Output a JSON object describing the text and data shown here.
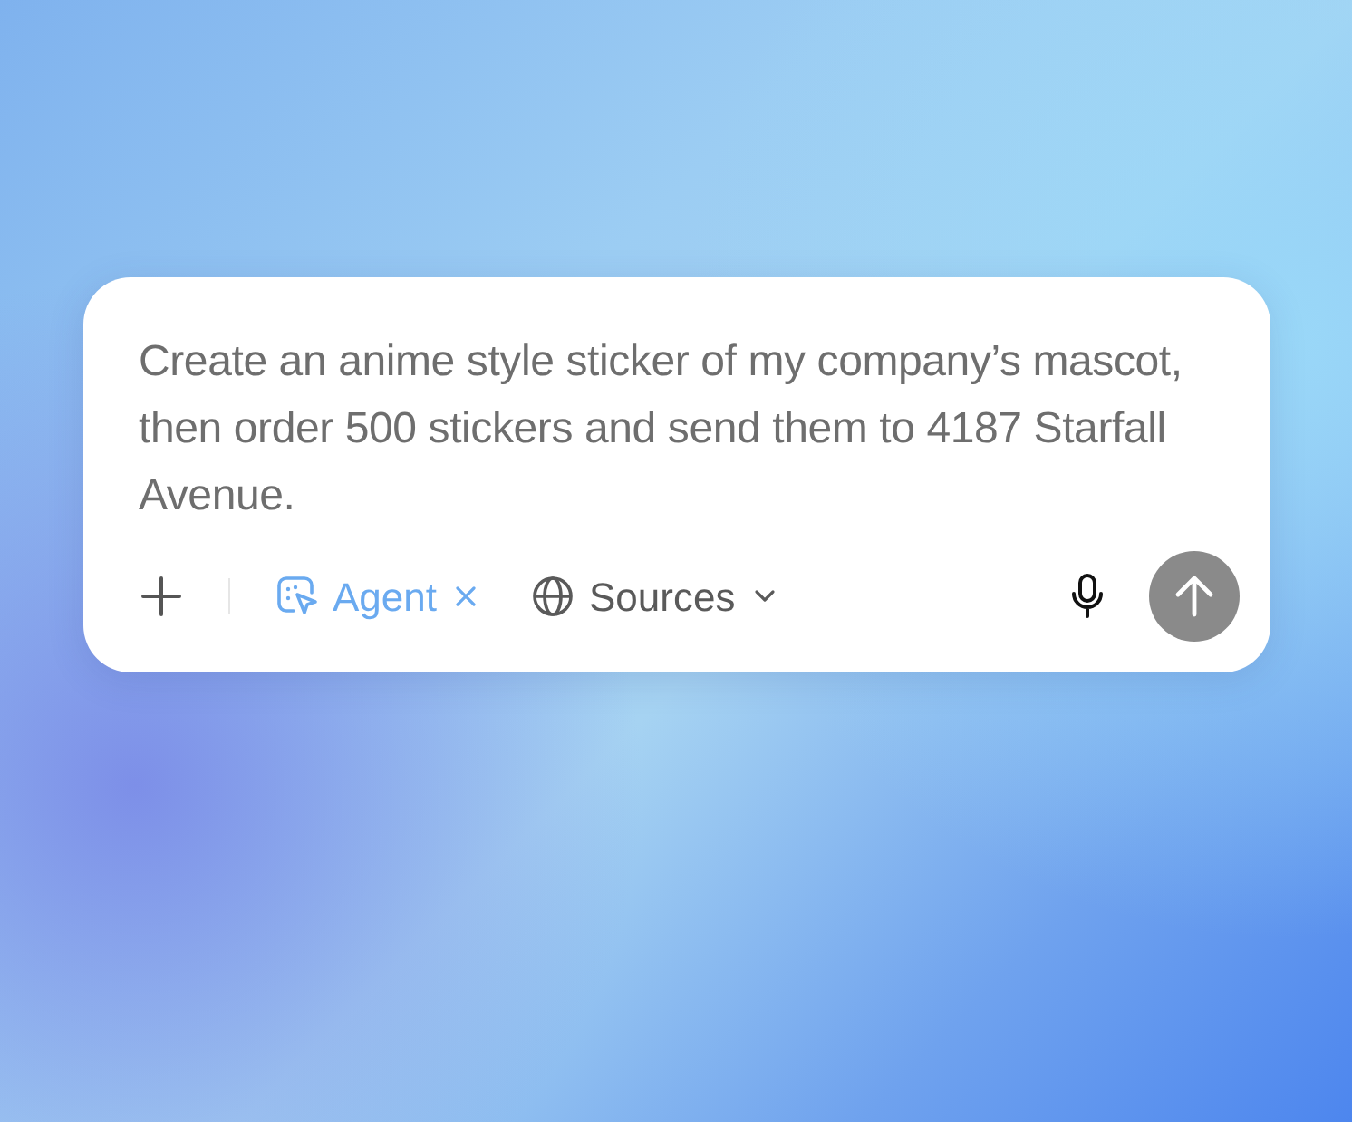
{
  "composer": {
    "value": "Create an anime style sticker of my company’s mascot, then order 500 stickers and send them to 4187 Starfall Avenue.",
    "tools": [
      {
        "kind": "agent",
        "label": "Agent",
        "active": true
      },
      {
        "kind": "sources",
        "label": "Sources",
        "active": false
      }
    ]
  }
}
